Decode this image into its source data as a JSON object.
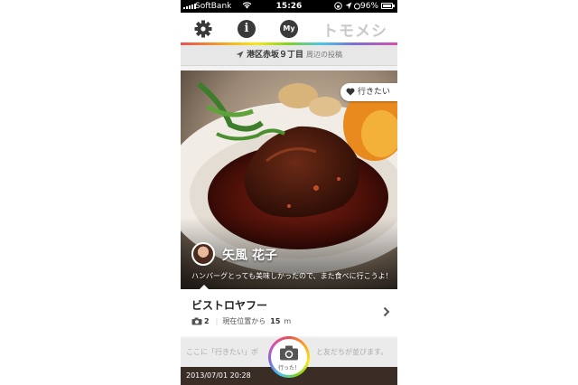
{
  "status_bar": {
    "carrier": "SoftBank",
    "time": "15:26",
    "battery": "96%"
  },
  "nav": {
    "title": "トモメシ",
    "my_label": "My",
    "info_label": "i",
    "accent_gradient": [
      "#e94f4f",
      "#f5a623",
      "#f8e71c",
      "#7ed321",
      "#4ac6e9",
      "#7b6fd6",
      "#d64fb0"
    ]
  },
  "location": {
    "name": "港区赤坂９丁目",
    "suffix": "周辺の投稿"
  },
  "post": {
    "want_label": "行きたい",
    "user_name": "矢風 花子",
    "comment": "ハンバーグとっても美味しかったので、また食べに行こうよ！"
  },
  "shop": {
    "name": "ビストロヤフー",
    "photo_count": "2",
    "distance_prefix": "現在位置から",
    "distance_value": "15",
    "distance_unit": "m"
  },
  "bottom": {
    "hint_left": "ここに「行きたい」ボ",
    "hint_right": "と友だちが並びます。",
    "camera_label": "行った！",
    "timestamp": "2013/07/01 20:28"
  }
}
